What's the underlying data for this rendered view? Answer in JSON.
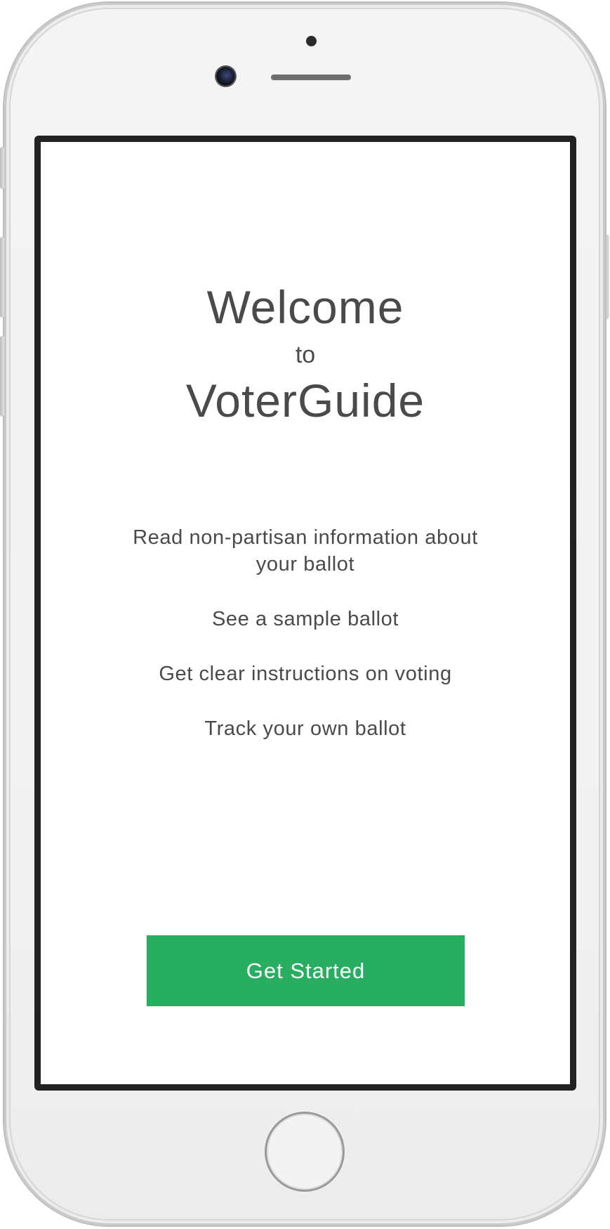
{
  "welcome": {
    "line1": "Welcome",
    "line2": "to",
    "app_name": "VoterGuide"
  },
  "features": [
    "Read non-partisan information about your ballot",
    "See a sample ballot",
    "Get clear instructions on voting",
    "Track your own ballot"
  ],
  "cta": {
    "label": "Get Started",
    "color": "#27ae60"
  },
  "icons": [
    "camera-icon",
    "proximity-sensor-icon",
    "speaker-icon",
    "home-button-icon"
  ]
}
